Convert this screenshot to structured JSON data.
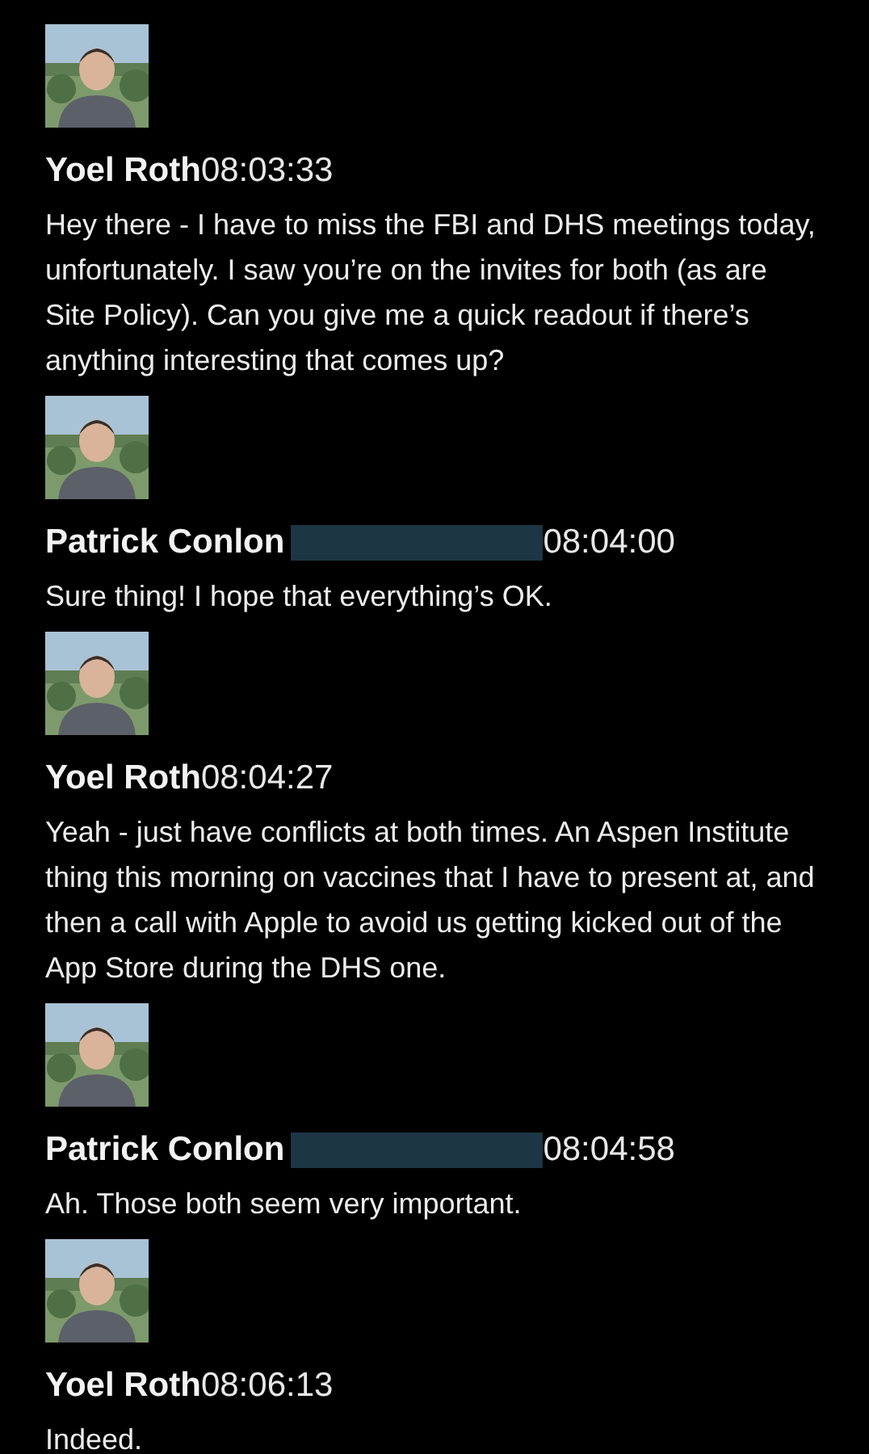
{
  "messages": [
    {
      "sender": "Yoel Roth",
      "redacted": false,
      "time": "08:03:33",
      "text": "Hey there - I have to miss the FBI and DHS meetings today, unfortunately. I saw you’re on the invites for both (as are Site Policy). Can you give me a quick readout if there’s anything interesting that comes up?"
    },
    {
      "sender": "Patrick Conlon",
      "redacted": true,
      "time": "08:04:00",
      "text": "Sure thing! I hope that everything’s OK."
    },
    {
      "sender": "Yoel Roth",
      "redacted": false,
      "time": "08:04:27",
      "text": "Yeah - just have conflicts at both times. An Aspen Institute thing this morning on vaccines that I have to present at, and then a call with Apple to avoid us getting kicked out of the App Store during the DHS one."
    },
    {
      "sender": "Patrick Conlon",
      "redacted": true,
      "time": "08:04:58",
      "text": "Ah. Those both seem very important."
    },
    {
      "sender": "Yoel Roth",
      "redacted": false,
      "time": "08:06:13",
      "text": "Indeed."
    }
  ]
}
